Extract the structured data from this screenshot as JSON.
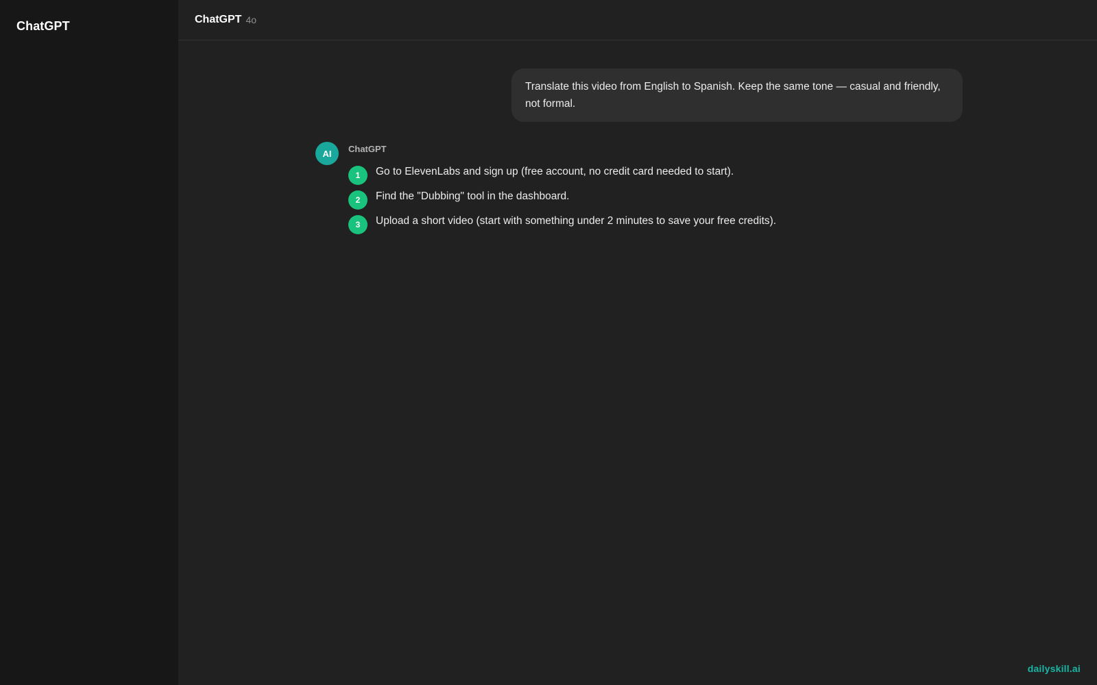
{
  "sidebar": {
    "brand": "ChatGPT"
  },
  "header": {
    "model_name": "ChatGPT",
    "model_version": "4o"
  },
  "conversation": {
    "user_message": "Translate this video from English to Spanish. Keep the same tone — casual and friendly, not formal.",
    "assistant": {
      "avatar_text": "AI",
      "name": "ChatGPT",
      "steps": [
        {
          "number": "1",
          "text": "Go to ElevenLabs and sign up (free account, no credit card needed to start)."
        },
        {
          "number": "2",
          "text": "Find the \"Dubbing\" tool in the dashboard."
        },
        {
          "number": "3",
          "text": "Upload a short video (start with something under 2 minutes to save your free credits)."
        }
      ]
    }
  },
  "watermark": "dailyskill.ai",
  "colors": {
    "sidebar_bg": "#171717",
    "main_bg": "#212121",
    "user_bubble_bg": "#2f2f2f",
    "avatar_bg": "#19a89b",
    "step_badge": "#19c37d",
    "watermark": "#19b5a5"
  }
}
